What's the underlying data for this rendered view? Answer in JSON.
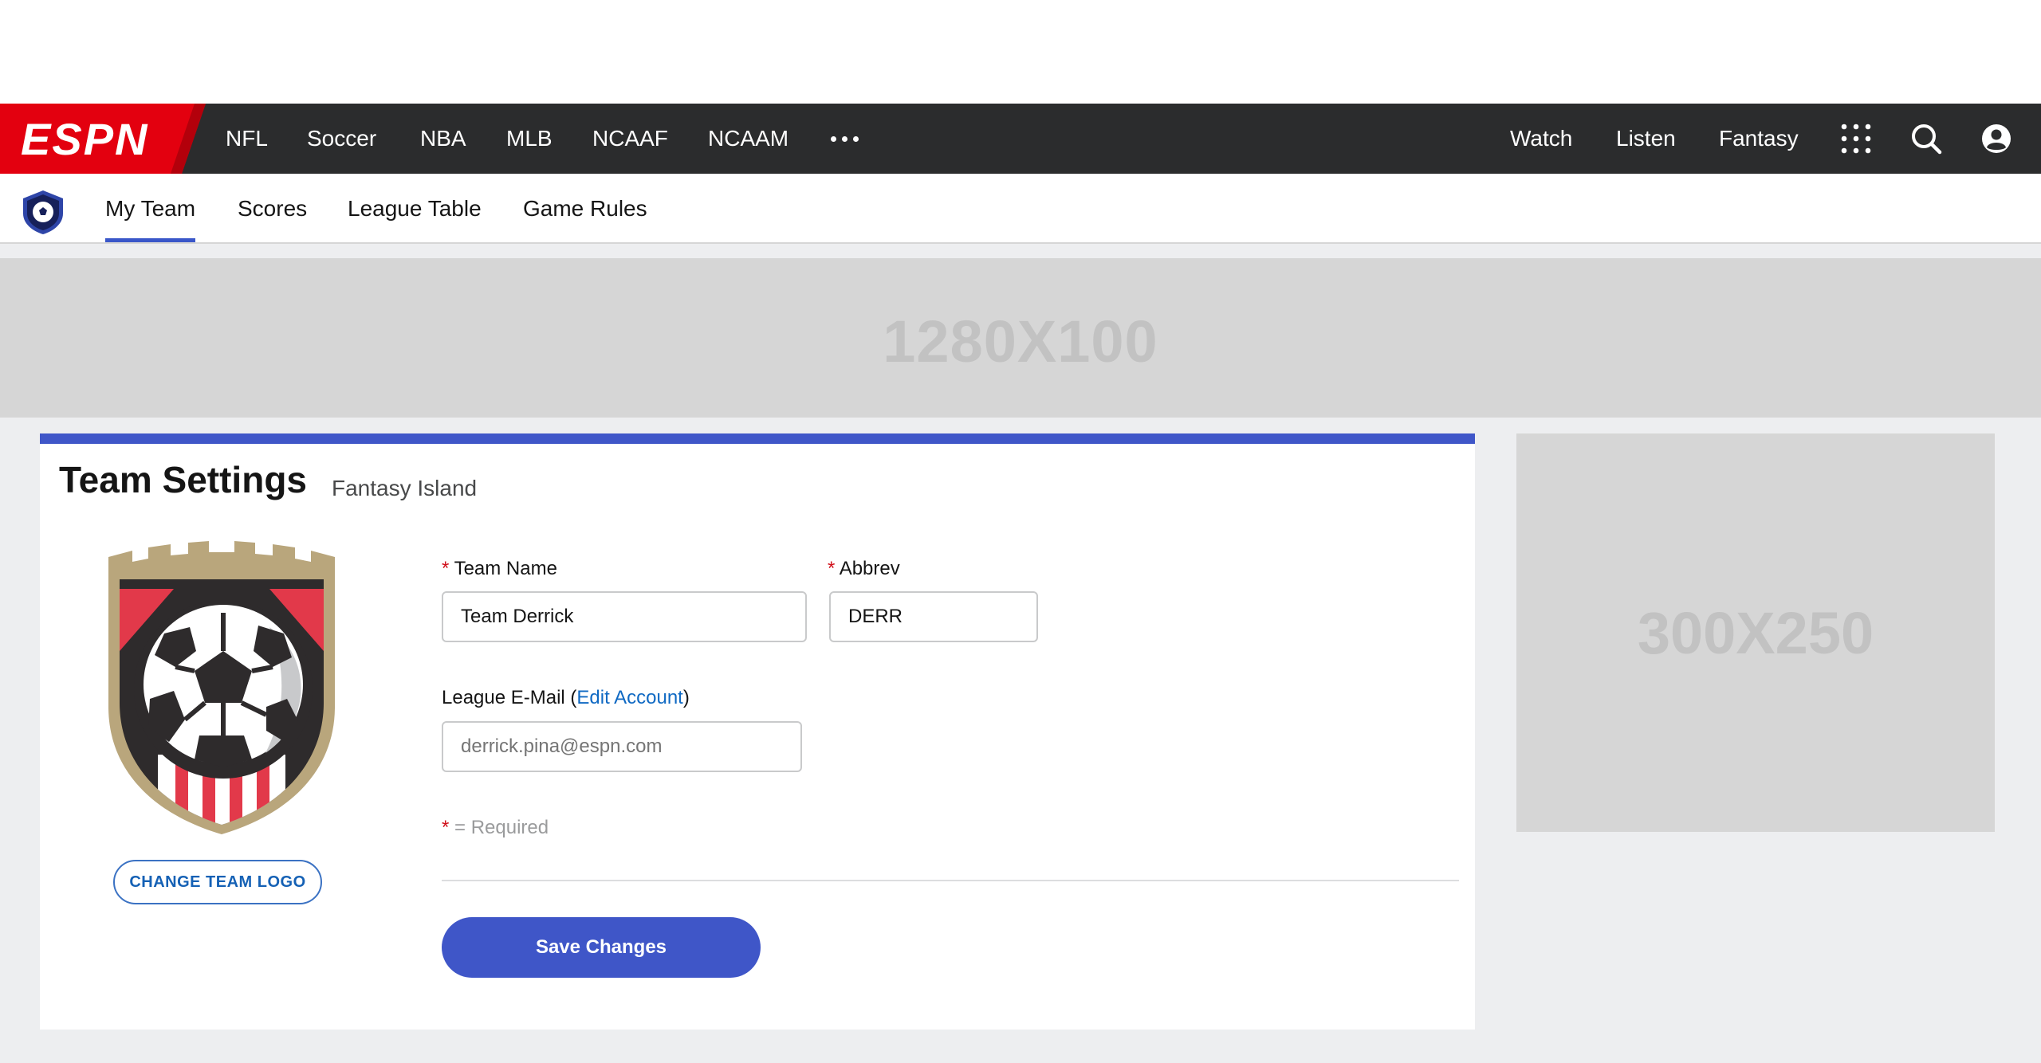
{
  "brand": {
    "logo_text": "ESPN",
    "brand_color": "#e3000f",
    "accent_color": "#3f56c8"
  },
  "global_nav": {
    "left_items": [
      "NFL",
      "Soccer",
      "NBA",
      "MLB",
      "NCAAF",
      "NCAAM"
    ],
    "more_icon": "ellipsis-icon",
    "right_items": [
      "Watch",
      "Listen",
      "Fantasy"
    ],
    "icons": [
      "apps-grid-icon",
      "search-icon",
      "user-account-icon"
    ]
  },
  "sub_nav": {
    "logo_icon": "soccer-shield-icon",
    "tabs": [
      "My Team",
      "Scores",
      "League Table",
      "Game Rules"
    ],
    "active_tab": "My Team"
  },
  "ads": {
    "leaderboard": "1280X100",
    "sidebar": "300X250"
  },
  "team_settings": {
    "title": "Team Settings",
    "league_name": "Fantasy Island",
    "crest_icon": "soccer-ball-crest-icon",
    "change_logo_label": "CHANGE TEAM LOGO",
    "required_marker": "*",
    "team_name_label": "Team Name",
    "team_name_value": "Team Derrick",
    "abbrev_label": "Abbrev",
    "abbrev_value": "DERR",
    "email_label_prefix": "League E-Mail (",
    "email_link": "Edit Account",
    "email_label_suffix": ")",
    "email_placeholder": "derrick.pina@espn.com",
    "required_note": "= Required",
    "save_label": "Save Changes"
  }
}
